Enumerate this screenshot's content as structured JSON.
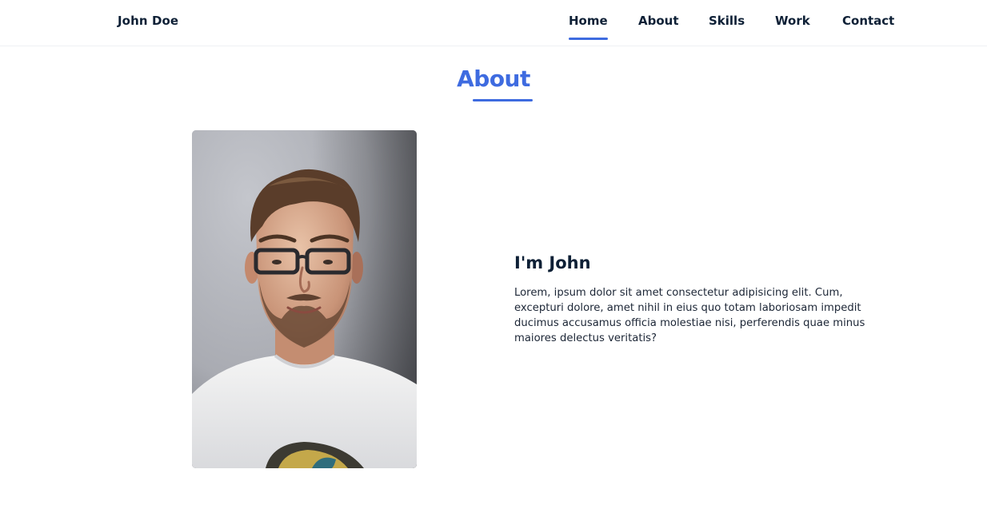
{
  "header": {
    "logo": "John Doe",
    "nav": [
      {
        "label": "Home",
        "active": true
      },
      {
        "label": "About",
        "active": false
      },
      {
        "label": "Skills",
        "active": false
      },
      {
        "label": "Work",
        "active": false
      },
      {
        "label": "Contact",
        "active": false
      }
    ]
  },
  "about": {
    "title": "About",
    "heading": "I'm John",
    "paragraph": "Lorem, ipsum dolor sit amet consectetur adipisicing elit. Cum, excepturi dolore, amet nihil in eius quo totam laboriosam impedit ducimus accusamus officia molestiae nisi, perferendis quae minus maiores delectus veritatis?"
  },
  "colors": {
    "accent": "#3e6be0",
    "text": "#0e2036"
  }
}
